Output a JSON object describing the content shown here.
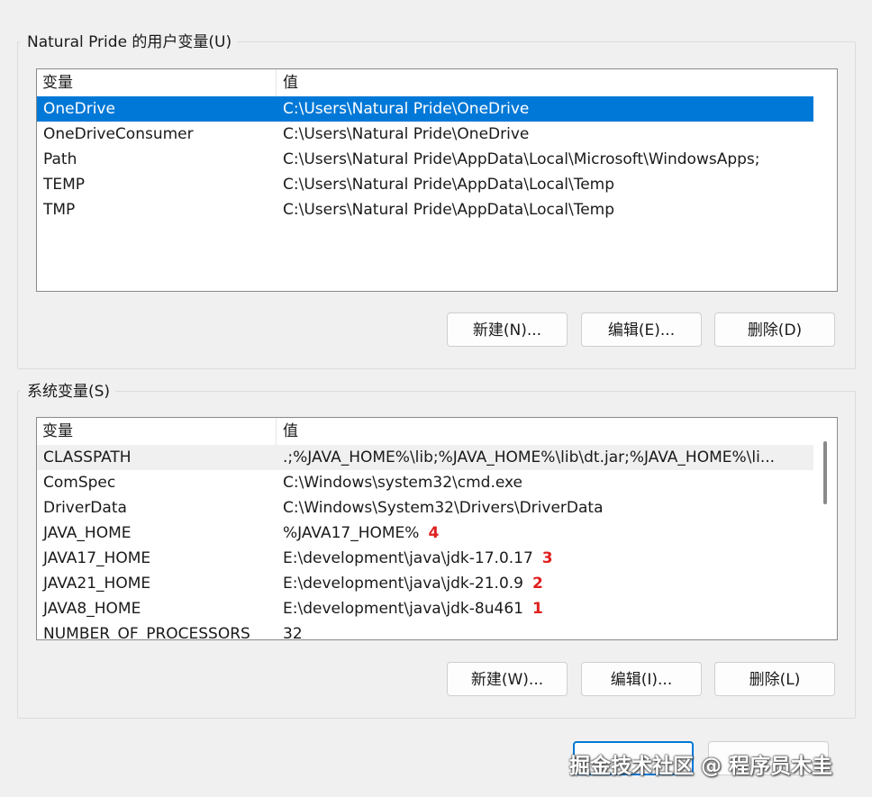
{
  "user_section": {
    "title": "Natural Pride 的用户变量(U)",
    "columns": {
      "name": "变量",
      "value": "值"
    },
    "rows": [
      {
        "name": "OneDrive",
        "value": "C:\\Users\\Natural Pride\\OneDrive"
      },
      {
        "name": "OneDriveConsumer",
        "value": "C:\\Users\\Natural Pride\\OneDrive"
      },
      {
        "name": "Path",
        "value": "C:\\Users\\Natural Pride\\AppData\\Local\\Microsoft\\WindowsApps;"
      },
      {
        "name": "TEMP",
        "value": "C:\\Users\\Natural Pride\\AppData\\Local\\Temp"
      },
      {
        "name": "TMP",
        "value": "C:\\Users\\Natural Pride\\AppData\\Local\\Temp"
      }
    ],
    "buttons": {
      "new": "新建(N)...",
      "edit": "编辑(E)...",
      "delete": "删除(D)"
    }
  },
  "system_section": {
    "title": "系统变量(S)",
    "columns": {
      "name": "变量",
      "value": "值"
    },
    "rows": [
      {
        "name": "CLASSPATH",
        "value": ".;%JAVA_HOME%\\lib;%JAVA_HOME%\\lib\\dt.jar;%JAVA_HOME%\\li...",
        "badge": ""
      },
      {
        "name": "ComSpec",
        "value": "C:\\Windows\\system32\\cmd.exe",
        "badge": ""
      },
      {
        "name": "DriverData",
        "value": "C:\\Windows\\System32\\Drivers\\DriverData",
        "badge": ""
      },
      {
        "name": "JAVA_HOME",
        "value": "%JAVA17_HOME%",
        "badge": "4"
      },
      {
        "name": "JAVA17_HOME",
        "value": "E:\\development\\java\\jdk-17.0.17",
        "badge": "3"
      },
      {
        "name": "JAVA21_HOME",
        "value": "E:\\development\\java\\jdk-21.0.9",
        "badge": "2"
      },
      {
        "name": "JAVA8_HOME",
        "value": "E:\\development\\java\\jdk-8u461",
        "badge": "1"
      },
      {
        "name": "NUMBER_OF_PROCESSORS",
        "value": "32",
        "badge": ""
      }
    ],
    "buttons": {
      "new": "新建(W)...",
      "edit": "编辑(I)...",
      "delete": "删除(L)"
    }
  },
  "watermark": "掘金技术社区 @ 程序员木圭",
  "colors": {
    "selection": "#0078d7",
    "badge": "#e02020"
  }
}
